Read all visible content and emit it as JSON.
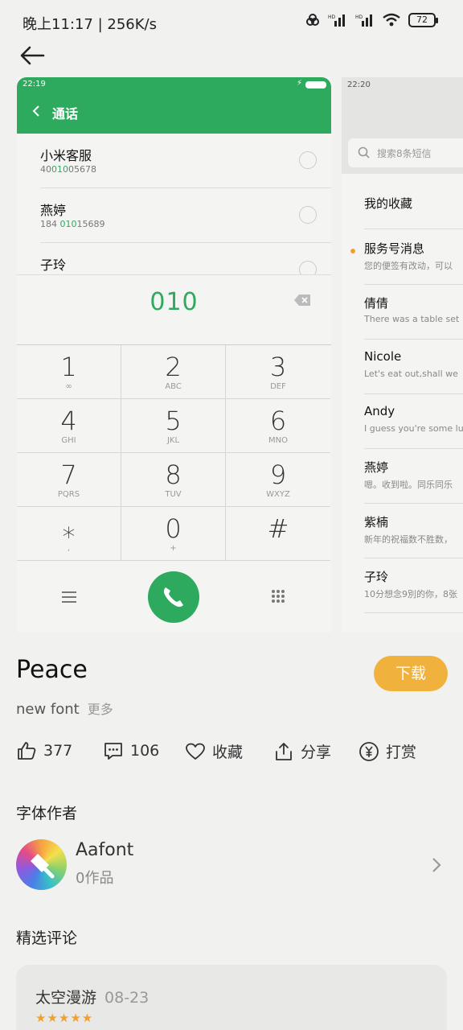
{
  "status_bar": {
    "time_speed": "晚上11:17 | 256K/s",
    "battery": "72"
  },
  "preview_dialer": {
    "status_time": "22:19",
    "header_title": "通话",
    "contacts": [
      {
        "name": "小米客服",
        "num_pre": "40",
        "num_hl": "010",
        "num_post": "05678"
      },
      {
        "name": "燕婷",
        "num_pre": "184 ",
        "num_hl": "010",
        "num_post": "15689"
      },
      {
        "name": "子玲",
        "num_pre": "",
        "num_hl": "",
        "num_post": ""
      }
    ],
    "dialed_number": "010",
    "keys": [
      {
        "digit": "1",
        "letters": ""
      },
      {
        "digit": "2",
        "letters": "ABC"
      },
      {
        "digit": "3",
        "letters": "DEF"
      },
      {
        "digit": "4",
        "letters": "GHI"
      },
      {
        "digit": "5",
        "letters": "JKL"
      },
      {
        "digit": "6",
        "letters": "MNO"
      },
      {
        "digit": "7",
        "letters": "PQRS"
      },
      {
        "digit": "8",
        "letters": "TUV"
      },
      {
        "digit": "9",
        "letters": "WXYZ"
      },
      {
        "digit": "⁎",
        "letters": ","
      },
      {
        "digit": "0",
        "letters": "+"
      },
      {
        "digit": "#",
        "letters": ""
      }
    ]
  },
  "preview_messages": {
    "status_time": "22:20",
    "search_placeholder": "搜索8条短信",
    "favorites": "我的收藏",
    "messages": [
      {
        "title": "服务号消息",
        "snippet": "您的便签有改动，可以"
      },
      {
        "title": "倩倩",
        "snippet": "There was a table set"
      },
      {
        "title": "Nicole",
        "snippet": "Let's eat out,shall we"
      },
      {
        "title": "Andy",
        "snippet": "I guess you're some lu"
      },
      {
        "title": "燕婷",
        "snippet": "嗯。收到啦。同乐同乐"
      },
      {
        "title": "紫楠",
        "snippet": "新年的祝福数不胜数，"
      },
      {
        "title": "子玲",
        "snippet": "10分想念9別的你，8张"
      }
    ]
  },
  "font_info": {
    "name": "Peace",
    "subtitle": "new font",
    "more": "更多",
    "download": "下载"
  },
  "actions": {
    "likes": "377",
    "comments": "106",
    "favorite": "收藏",
    "share": "分享",
    "tip": "打赏"
  },
  "author_section": {
    "title": "字体作者",
    "name": "Aafont",
    "works": "0作品"
  },
  "comments_section": {
    "title": "精选评论",
    "first": {
      "user": "太空漫游",
      "date": "08-23",
      "stars": "★★★★★"
    }
  },
  "colors": {
    "accent_green": "#2daa5e",
    "download_orange": "#f0b23c"
  }
}
